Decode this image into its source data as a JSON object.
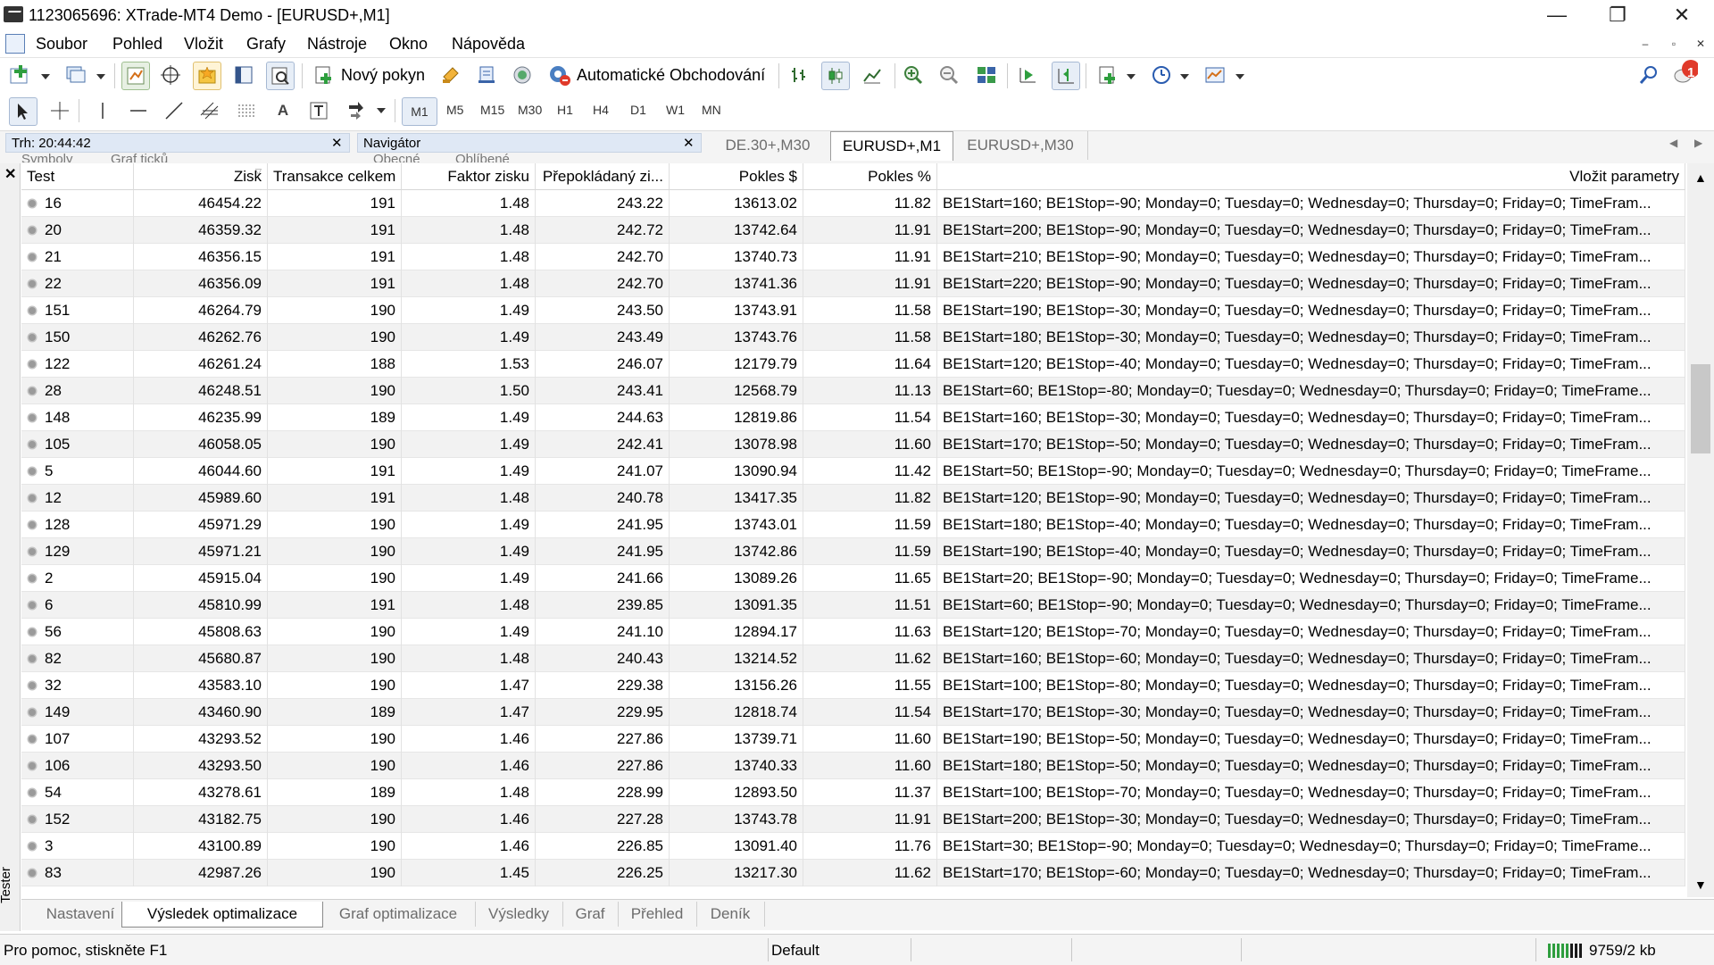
{
  "window": {
    "title": "1123065696: XTrade-MT4 Demo - [EURUSD+,M1]",
    "minimize": "—",
    "maximize": "❐",
    "close": "✕"
  },
  "menu": [
    "Soubor",
    "Pohled",
    "Vložit",
    "Grafy",
    "Nástroje",
    "Okno",
    "Nápověda"
  ],
  "toolbar": {
    "new_order_label": "Nový pokyn",
    "auto_trading_label": "Automatické Obchodování",
    "timeframes": [
      "M1",
      "M5",
      "M15",
      "M30",
      "H1",
      "H4",
      "D1",
      "W1",
      "MN"
    ],
    "notification_count": "1",
    "text_tool": "A"
  },
  "market_watch": {
    "label": "Trh: 20:44:42",
    "tabs": [
      "Symboly",
      "Graf ticků"
    ]
  },
  "navigator": {
    "label": "Navigátor",
    "tabs": [
      "Obecné",
      "Oblíbené"
    ]
  },
  "chart_tabs": [
    {
      "label": "DE.30+,M30",
      "active": false
    },
    {
      "label": "EURUSD+,M1",
      "active": true
    },
    {
      "label": "EURUSD+,M30",
      "active": false
    }
  ],
  "tester": {
    "side_label": "Tester",
    "columns": [
      "Test",
      "Zisk",
      "Transakce celkem",
      "Faktor zisku",
      "Přepokládaný zi...",
      "Pokles $",
      "Pokles %",
      "Vložit parametry"
    ],
    "rows": [
      [
        "16",
        "46454.22",
        "191",
        "1.48",
        "243.22",
        "13613.02",
        "11.82",
        "BE1Start=160; BE1Stop=-90; Monday=0; Tuesday=0; Wednesday=0; Thursday=0; Friday=0; TimeFram..."
      ],
      [
        "20",
        "46359.32",
        "191",
        "1.48",
        "242.72",
        "13742.64",
        "11.91",
        "BE1Start=200; BE1Stop=-90; Monday=0; Tuesday=0; Wednesday=0; Thursday=0; Friday=0; TimeFram..."
      ],
      [
        "21",
        "46356.15",
        "191",
        "1.48",
        "242.70",
        "13740.73",
        "11.91",
        "BE1Start=210; BE1Stop=-90; Monday=0; Tuesday=0; Wednesday=0; Thursday=0; Friday=0; TimeFram..."
      ],
      [
        "22",
        "46356.09",
        "191",
        "1.48",
        "242.70",
        "13741.36",
        "11.91",
        "BE1Start=220; BE1Stop=-90; Monday=0; Tuesday=0; Wednesday=0; Thursday=0; Friday=0; TimeFram..."
      ],
      [
        "151",
        "46264.79",
        "190",
        "1.49",
        "243.50",
        "13743.91",
        "11.58",
        "BE1Start=190; BE1Stop=-30; Monday=0; Tuesday=0; Wednesday=0; Thursday=0; Friday=0; TimeFram..."
      ],
      [
        "150",
        "46262.76",
        "190",
        "1.49",
        "243.49",
        "13743.76",
        "11.58",
        "BE1Start=180; BE1Stop=-30; Monday=0; Tuesday=0; Wednesday=0; Thursday=0; Friday=0; TimeFram..."
      ],
      [
        "122",
        "46261.24",
        "188",
        "1.53",
        "246.07",
        "12179.79",
        "11.64",
        "BE1Start=120; BE1Stop=-40; Monday=0; Tuesday=0; Wednesday=0; Thursday=0; Friday=0; TimeFram..."
      ],
      [
        "28",
        "46248.51",
        "190",
        "1.50",
        "243.41",
        "12568.79",
        "11.13",
        "BE1Start=60; BE1Stop=-80; Monday=0; Tuesday=0; Wednesday=0; Thursday=0; Friday=0; TimeFrame..."
      ],
      [
        "148",
        "46235.99",
        "189",
        "1.49",
        "244.63",
        "12819.86",
        "11.54",
        "BE1Start=160; BE1Stop=-30; Monday=0; Tuesday=0; Wednesday=0; Thursday=0; Friday=0; TimeFram..."
      ],
      [
        "105",
        "46058.05",
        "190",
        "1.49",
        "242.41",
        "13078.98",
        "11.60",
        "BE1Start=170; BE1Stop=-50; Monday=0; Tuesday=0; Wednesday=0; Thursday=0; Friday=0; TimeFram..."
      ],
      [
        "5",
        "46044.60",
        "191",
        "1.49",
        "241.07",
        "13090.94",
        "11.42",
        "BE1Start=50; BE1Stop=-90; Monday=0; Tuesday=0; Wednesday=0; Thursday=0; Friday=0; TimeFrame..."
      ],
      [
        "12",
        "45989.60",
        "191",
        "1.48",
        "240.78",
        "13417.35",
        "11.82",
        "BE1Start=120; BE1Stop=-90; Monday=0; Tuesday=0; Wednesday=0; Thursday=0; Friday=0; TimeFram..."
      ],
      [
        "128",
        "45971.29",
        "190",
        "1.49",
        "241.95",
        "13743.01",
        "11.59",
        "BE1Start=180; BE1Stop=-40; Monday=0; Tuesday=0; Wednesday=0; Thursday=0; Friday=0; TimeFram..."
      ],
      [
        "129",
        "45971.21",
        "190",
        "1.49",
        "241.95",
        "13742.86",
        "11.59",
        "BE1Start=190; BE1Stop=-40; Monday=0; Tuesday=0; Wednesday=0; Thursday=0; Friday=0; TimeFram..."
      ],
      [
        "2",
        "45915.04",
        "190",
        "1.49",
        "241.66",
        "13089.26",
        "11.65",
        "BE1Start=20; BE1Stop=-90; Monday=0; Tuesday=0; Wednesday=0; Thursday=0; Friday=0; TimeFrame..."
      ],
      [
        "6",
        "45810.99",
        "191",
        "1.48",
        "239.85",
        "13091.35",
        "11.51",
        "BE1Start=60; BE1Stop=-90; Monday=0; Tuesday=0; Wednesday=0; Thursday=0; Friday=0; TimeFrame..."
      ],
      [
        "56",
        "45808.63",
        "190",
        "1.49",
        "241.10",
        "12894.17",
        "11.63",
        "BE1Start=120; BE1Stop=-70; Monday=0; Tuesday=0; Wednesday=0; Thursday=0; Friday=0; TimeFram..."
      ],
      [
        "82",
        "45680.87",
        "190",
        "1.48",
        "240.43",
        "13214.52",
        "11.62",
        "BE1Start=160; BE1Stop=-60; Monday=0; Tuesday=0; Wednesday=0; Thursday=0; Friday=0; TimeFram..."
      ],
      [
        "32",
        "43583.10",
        "190",
        "1.47",
        "229.38",
        "13156.26",
        "11.55",
        "BE1Start=100; BE1Stop=-80; Monday=0; Tuesday=0; Wednesday=0; Thursday=0; Friday=0; TimeFram..."
      ],
      [
        "149",
        "43460.90",
        "189",
        "1.47",
        "229.95",
        "12818.74",
        "11.54",
        "BE1Start=170; BE1Stop=-30; Monday=0; Tuesday=0; Wednesday=0; Thursday=0; Friday=0; TimeFram..."
      ],
      [
        "107",
        "43293.52",
        "190",
        "1.46",
        "227.86",
        "13739.71",
        "11.60",
        "BE1Start=190; BE1Stop=-50; Monday=0; Tuesday=0; Wednesday=0; Thursday=0; Friday=0; TimeFram..."
      ],
      [
        "106",
        "43293.50",
        "190",
        "1.46",
        "227.86",
        "13740.33",
        "11.60",
        "BE1Start=180; BE1Stop=-50; Monday=0; Tuesday=0; Wednesday=0; Thursday=0; Friday=0; TimeFram..."
      ],
      [
        "54",
        "43278.61",
        "189",
        "1.48",
        "228.99",
        "12893.50",
        "11.37",
        "BE1Start=100; BE1Stop=-70; Monday=0; Tuesday=0; Wednesday=0; Thursday=0; Friday=0; TimeFram..."
      ],
      [
        "152",
        "43182.75",
        "190",
        "1.46",
        "227.28",
        "13743.78",
        "11.91",
        "BE1Start=200; BE1Stop=-30; Monday=0; Tuesday=0; Wednesday=0; Thursday=0; Friday=0; TimeFram..."
      ],
      [
        "3",
        "43100.89",
        "190",
        "1.46",
        "226.85",
        "13091.40",
        "11.76",
        "BE1Start=30; BE1Stop=-90; Monday=0; Tuesday=0; Wednesday=0; Thursday=0; Friday=0; TimeFrame..."
      ],
      [
        "83",
        "42987.26",
        "190",
        "1.45",
        "226.25",
        "13217.30",
        "11.62",
        "BE1Start=170; BE1Stop=-60; Monday=0; Tuesday=0; Wednesday=0; Thursday=0; Friday=0; TimeFram..."
      ]
    ],
    "bottom_tabs": [
      {
        "label": "Nastavení",
        "active": false
      },
      {
        "label": "Výsledek optimalizace",
        "active": true
      },
      {
        "label": "Graf optimalizace",
        "active": false
      },
      {
        "label": "Výsledky",
        "active": false
      },
      {
        "label": "Graf",
        "active": false
      },
      {
        "label": "Přehled",
        "active": false
      },
      {
        "label": "Deník",
        "active": false
      }
    ]
  },
  "status": {
    "help": "Pro pomoc, stiskněte F1",
    "profile": "Default",
    "traffic": "9759/2 kb"
  },
  "colors": {
    "accent_green": "#2e9e3e",
    "notification_red": "#e03a2a",
    "panel_header": "#dfe8f5"
  }
}
